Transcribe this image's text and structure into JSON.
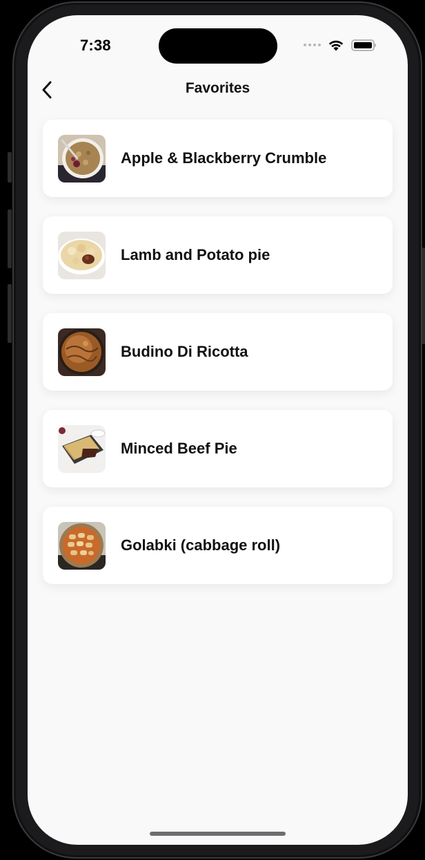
{
  "status_bar": {
    "time": "7:38",
    "icons": [
      "cellular-dots-icon",
      "wifi-icon",
      "battery-icon"
    ]
  },
  "nav": {
    "title": "Favorites",
    "back_icon": "chevron-left-icon"
  },
  "favorites": [
    {
      "label": "Apple & Blackberry Crumble",
      "thumb": "crumble-thumbnail"
    },
    {
      "label": "Lamb and Potato pie",
      "thumb": "lamb-pie-thumbnail"
    },
    {
      "label": "Budino Di Ricotta",
      "thumb": "ricotta-thumbnail"
    },
    {
      "label": "Minced Beef Pie",
      "thumb": "beef-pie-thumbnail"
    },
    {
      "label": "Golabki (cabbage roll)",
      "thumb": "golabki-thumbnail"
    }
  ],
  "colors": {
    "screen_bg": "#f9f9f9",
    "card_bg": "#ffffff",
    "text": "#111111"
  }
}
